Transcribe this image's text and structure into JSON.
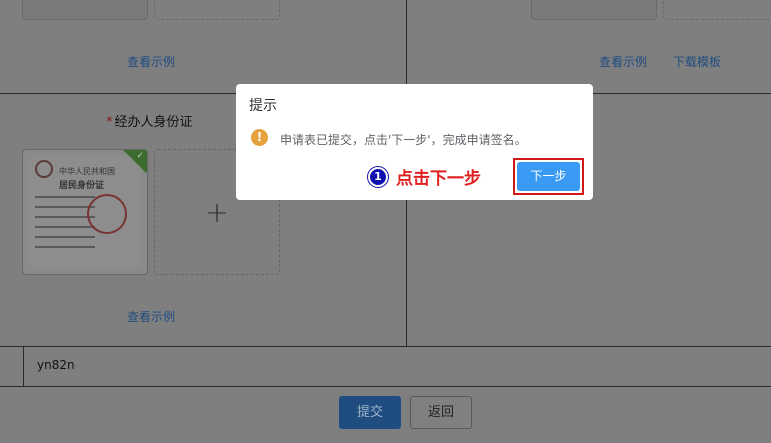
{
  "page": {
    "top_links": {
      "left_example": "查看示例",
      "right_example": "查看示例",
      "right_template": "下载模板"
    },
    "agent_id": {
      "required_mark": "*",
      "label": "经办人身份证",
      "card_title": "中华人民共和国",
      "card_subtitle": "居民身份证",
      "plus": "+",
      "example_link": "查看示例"
    },
    "input_value": "yn82n",
    "buttons": {
      "submit": "提交",
      "back": "返回"
    }
  },
  "dialog": {
    "title": "提示",
    "warn_icon": "!",
    "message": "申请表已提交，点击'下一步'，完成申请签名。",
    "next_button": "下一步"
  },
  "annotation": {
    "step_number": "1",
    "step_text": "点击下一步"
  },
  "colors": {
    "accent": "#3a9bf5",
    "warning": "#e6a23c",
    "highlight": "#d01818"
  }
}
